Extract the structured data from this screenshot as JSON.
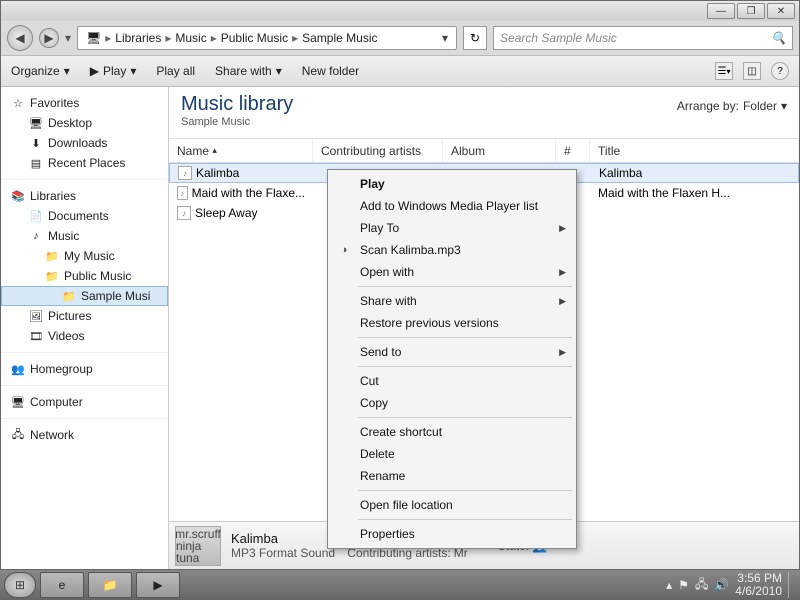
{
  "window": {
    "min": "—",
    "max": "❐",
    "close": "✕"
  },
  "breadcrumb": {
    "segments": [
      "Libraries",
      "Music",
      "Public Music",
      "Sample Music"
    ]
  },
  "search": {
    "placeholder": "Search Sample Music"
  },
  "toolbar": {
    "organize": "Organize",
    "play": "Play",
    "play_all": "Play all",
    "share_with": "Share with",
    "new_folder": "New folder"
  },
  "tree": {
    "favorites": "Favorites",
    "desktop": "Desktop",
    "downloads": "Downloads",
    "recent": "Recent Places",
    "libraries": "Libraries",
    "documents": "Documents",
    "music": "Music",
    "my_music": "My Music",
    "public_music": "Public Music",
    "sample_music": "Sample Musi",
    "pictures": "Pictures",
    "videos": "Videos",
    "homegroup": "Homegroup",
    "computer": "Computer",
    "network": "Network"
  },
  "library": {
    "title": "Music library",
    "subtitle": "Sample Music",
    "arrange_label": "Arrange by:",
    "arrange_value": "Folder"
  },
  "columns": {
    "name": "Name",
    "artist": "Contributing artists",
    "album": "Album",
    "num": "#",
    "title": "Title"
  },
  "files": [
    {
      "name": "Kalimba",
      "title": "Kalimba"
    },
    {
      "name": "Maid with the Flaxe...",
      "title": "Maid with the Flaxen H..."
    },
    {
      "name": "Sleep Away",
      "title": ""
    }
  ],
  "context_menu": {
    "play": "Play",
    "add_wmp": "Add to Windows Media Player list",
    "play_to": "Play To",
    "scan": "Scan Kalimba.mp3",
    "open_with": "Open with",
    "share_with": "Share with",
    "restore": "Restore previous versions",
    "send_to": "Send to",
    "cut": "Cut",
    "copy": "Copy",
    "shortcut": "Create shortcut",
    "delete": "Delete",
    "rename": "Rename",
    "open_loc": "Open file location",
    "properties": "Properties"
  },
  "details": {
    "thumb_l1": "mr.scruff",
    "thumb_l2": "ninja tuna",
    "name": "Kalimba",
    "format": "MP3 Format Sound",
    "state_label": "State:",
    "artists_label": "Contributing artists:",
    "artists_value": "Mr"
  },
  "taskbar": {
    "time": "3:56 PM",
    "date": "4/6/2010"
  }
}
